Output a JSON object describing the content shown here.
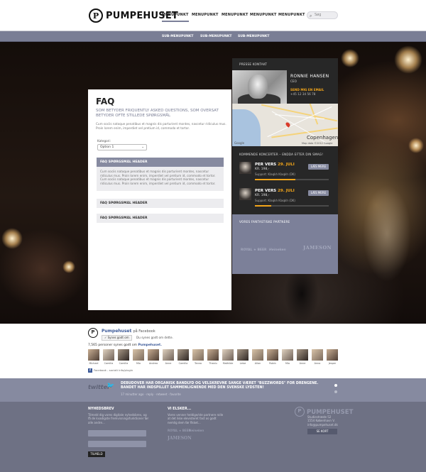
{
  "header": {
    "brand": "PUMPEHUSET",
    "brand_mark": "P",
    "nav": [
      "MENUPUNKT",
      "MENUPUNKT",
      "MENUPUNKT",
      "MENUPUNKT",
      "MENUPUNKT"
    ],
    "active_nav_index": 0,
    "search_placeholder": "Søg"
  },
  "subnav": [
    "SUB-MENUPUNKT",
    "SUB-MENUPUNKT",
    "SUB-MENUPUNKT"
  ],
  "faq": {
    "title": "FAQ",
    "lead": "SOM BETYDER FRIQUENTLY ASKED QUESTIONS, SOM OVERSAT BETYDER OFTE STILLEDE SPØRGSMÅL",
    "intro": "Cum sociis natoque penatibus et magnis dis parturient montes, nascetur ridiculus mus. Proin lorem enim, imperdiet vel pretium id, commodo et tortor.",
    "category_label": "Kategori:",
    "category_value": "Option 1",
    "questions": [
      {
        "header": "FAQ SPØRGSMÅL HEADER",
        "answer": "Cum sociis natoque penatibus et magnis dis parturient montes, nascetur ridiculus mus. Proin lorem enim, imperdiet vel pretium id, commodo et tortor. Cum sociis natoque penatibus et magnis dis parturient montes, nascetur ridiculus mus. Proin lorem enim, imperdiet vel pretium id, commodo et tortor."
      },
      {
        "header": "FAQ SPØRGSMÅL HEADER"
      },
      {
        "header": "FAQ SPØRGSMÅL HEADER"
      }
    ]
  },
  "side": {
    "contact_label": "PRESSE KONTAKT",
    "contact_name": "RONNIE HANSEN",
    "contact_role": "CEO",
    "contact_mail": "SEND MIG EN EMAIL",
    "contact_phone": "+45 12 34 56 78",
    "map_city": "Copenhagen",
    "map_copy": "Map data ©2012 Google",
    "map_logo": "Google",
    "concerts_label": "KOMMENDE KONCERTER – ENDDA EFTER DIN SMAG!",
    "concerts": [
      {
        "title": "PER VERS",
        "date": "29. JULI",
        "price": "KR. 198,-",
        "support": "Support: Klaqkh Klaqkh (DK)",
        "button": "LÆS MERE",
        "progress": 0.55
      },
      {
        "title": "PER VERS",
        "date": "29. JULI",
        "price": "KR. 198,-",
        "support": "Support: Klaqkh Klaqkh (DK)",
        "button": "LÆS MERE",
        "progress": 0.22
      }
    ],
    "partners_label": "VORES FANTASTISKE PARTNERE",
    "partners": [
      "ROYAL ★ BEER",
      "Heineken",
      "JAMESON"
    ]
  },
  "facebook": {
    "page_name": "Pumpehuset",
    "on_facebook": "på Facebook",
    "like_button": "Synes godt om",
    "like_text": "Du synes godt om dette.",
    "count_text": "7,565 personer synes godt om",
    "count_page": "Pumpehuset.",
    "fans": [
      "Michael",
      "Camilla",
      "Camilla",
      "Mia",
      "Andrea",
      "Anne",
      "Camilla",
      "Tanna",
      "Thealu",
      "Mathilde",
      "Leise",
      "Allan",
      "Robin",
      "Mia",
      "Anne",
      "Anna",
      "Jesper"
    ],
    "plugin_text": "Facebook - socialt info/plugin"
  },
  "twitter": {
    "logo": "twitter",
    "text": "DEBUDOVER HAR ORGANISK BANDLYD OG VELSKREVNE SANGE VÆRET \"BUZZWORDS\" FOR DRENGENE. BANDET HAR INDSPILLET SAMMENLIGNENDE MED DEN SVENSKE LYDSTEN!",
    "meta": "17 minutter ago · reply · retweet · favorite"
  },
  "footer": {
    "newsletter_title": "NYHEDSBREV",
    "newsletter_text": "Tilmeld dig vores digitale nyhedsbrev, og få de kvadigste fremvisningsfunktioner før alle andre...",
    "subscribe_button": "TILMELD",
    "love_title": "VI ELSKER...",
    "love_text": "Vores venner heldige/ste partnere rolle at det ikke elevisteret fast os godt nemlig dem før fikket...",
    "love_partners": [
      "ROYAL ★ BEER",
      "Heineken",
      "JAMESON"
    ],
    "brand": "PUMPEHUSET",
    "address": [
      "Studiestræde 52",
      "1554 København V.",
      "info@pumpehuset.dk"
    ],
    "map_button": "SE KORT"
  },
  "colors": {
    "accent": "#868aa0",
    "orange": "#f2a51a",
    "dark_panel": "#272727",
    "footer": "#6e7184"
  }
}
